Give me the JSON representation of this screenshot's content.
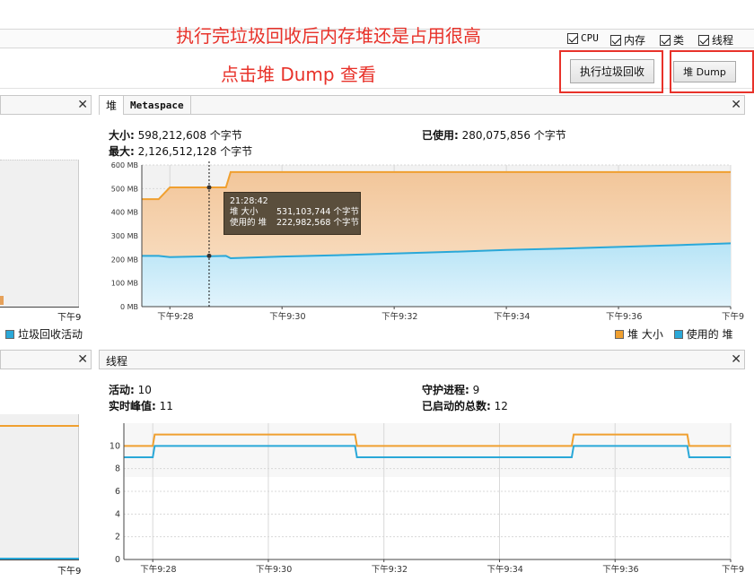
{
  "annotations": {
    "line1": "执行完垃圾回收后内存堆还是占用很高",
    "line2": "点击堆 Dump 查看"
  },
  "monitors": [
    {
      "key": "cpu",
      "label": "CPU",
      "checked": true
    },
    {
      "key": "memory",
      "label": "内存",
      "checked": true
    },
    {
      "key": "classes",
      "label": "类",
      "checked": true
    },
    {
      "key": "threads",
      "label": "线程",
      "checked": true
    }
  ],
  "buttons": {
    "gc": "执行垃圾回收",
    "heap_dump": "堆 Dump"
  },
  "left_top": {
    "legend": "垃圾回收活动",
    "x_tick": "下午9"
  },
  "left_bottom": {
    "x_tick": "下午9"
  },
  "heap_panel": {
    "tab_heap": "堆",
    "tab_metaspace": "Metaspace",
    "size_label": "大小:",
    "size_value": "598,212,608 个字节",
    "max_label": "最大:",
    "max_value": "2,126,512,128 个字节",
    "used_label": "已使用:",
    "used_value": "280,075,856 个字节",
    "tooltip": {
      "time": "21:28:42",
      "row1_label": "堆 大小",
      "row1_value": "531,103,744 个字节",
      "row2_label": "使用的 堆",
      "row2_value": "222,982,568 个字节"
    },
    "legend_size": "堆 大小",
    "legend_used": "使用的 堆",
    "chart_data": {
      "type": "area",
      "title": "",
      "xlabel": "",
      "ylabel": "",
      "y_ticks": [
        "0 MB",
        "100 MB",
        "200 MB",
        "300 MB",
        "400 MB",
        "500 MB",
        "600 MB"
      ],
      "ylim": [
        0,
        600
      ],
      "x_ticks": [
        "下午9:28",
        "下午9:30",
        "下午9:32",
        "下午9:34",
        "下午9:36",
        "下午9"
      ],
      "series": [
        {
          "name": "堆 大小",
          "color": "#f0a030",
          "x": [
            "21:27:30",
            "21:27:48",
            "21:28:00",
            "21:29:00",
            "21:29:05",
            "21:38:00"
          ],
          "values": [
            455,
            455,
            505,
            505,
            570,
            570
          ]
        },
        {
          "name": "使用的 堆",
          "color": "#2aa8d8",
          "x": [
            "21:27:30",
            "21:27:48",
            "21:28:00",
            "21:29:00",
            "21:29:05",
            "21:30:00",
            "21:31:00",
            "21:32:00",
            "21:33:00",
            "21:34:00",
            "21:35:00",
            "21:36:00",
            "21:37:00",
            "21:38:00"
          ],
          "values": [
            215,
            215,
            210,
            215,
            205,
            212,
            218,
            225,
            232,
            240,
            246,
            253,
            260,
            268
          ]
        }
      ]
    }
  },
  "threads_panel": {
    "title": "线程",
    "live_label": "活动:",
    "live_value": "10",
    "peak_label": "实时峰值:",
    "peak_value": "11",
    "daemon_label": "守护进程:",
    "daemon_value": "9",
    "started_label": "已启动的总数:",
    "started_value": "12",
    "chart_data": {
      "type": "line",
      "title": "",
      "xlabel": "",
      "ylabel": "",
      "y_ticks": [
        "0",
        "2",
        "4",
        "6",
        "8",
        "10"
      ],
      "ylim": [
        0,
        12
      ],
      "x_ticks": [
        "下午9:28",
        "下午9:30",
        "下午9:32",
        "下午9:34",
        "下午9:36",
        "下午9"
      ],
      "series": [
        {
          "name": "",
          "color": "#f0a030",
          "x": [
            "21:27:30",
            "21:28:00",
            "21:28:02",
            "21:31:30",
            "21:31:32",
            "21:35:15",
            "21:35:17",
            "21:37:15",
            "21:37:17",
            "21:38:00"
          ],
          "values": [
            10,
            10,
            11,
            11,
            10,
            10,
            11,
            11,
            10,
            10
          ]
        },
        {
          "name": "",
          "color": "#2aa8d8",
          "x": [
            "21:27:30",
            "21:28:00",
            "21:28:02",
            "21:31:30",
            "21:31:32",
            "21:35:15",
            "21:35:17",
            "21:37:15",
            "21:37:17",
            "21:38:00"
          ],
          "values": [
            9,
            9,
            10,
            10,
            9,
            9,
            10,
            10,
            9,
            9
          ]
        }
      ]
    }
  }
}
